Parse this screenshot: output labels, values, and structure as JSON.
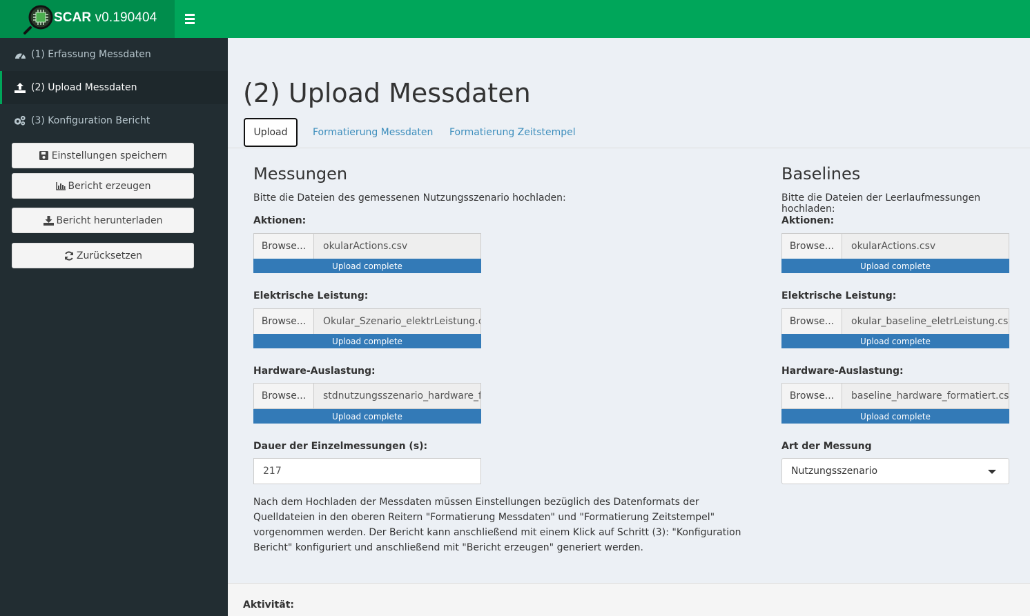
{
  "app": {
    "logo_mark": "O",
    "title": "SCAR",
    "version": "v0.190404",
    "logo_icon": "magnifier-chip-icon"
  },
  "sidebar": {
    "items": [
      {
        "label": "(1) Erfassung Messdaten",
        "icon": "dashboard-icon"
      },
      {
        "label": "(2) Upload Messdaten",
        "icon": "upload-icon"
      },
      {
        "label": "(3) Konfiguration Bericht",
        "icon": "gears-icon"
      }
    ],
    "buttons": [
      {
        "label": "Einstellungen speichern",
        "icon": "floppy-icon"
      },
      {
        "label": "Bericht erzeugen",
        "icon": "bar-chart-icon"
      },
      {
        "label": "Bericht herunterladen",
        "icon": "download-icon"
      },
      {
        "label": "Zurücksetzen",
        "icon": "refresh-icon"
      }
    ]
  },
  "page": {
    "title": "(2) Upload Messdaten",
    "tabs": [
      "Upload",
      "Formatierung Messdaten",
      "Formatierung Zeitstempel"
    ]
  },
  "messungen": {
    "title": "Messungen",
    "desc": "Bitte die Dateien des gemessenen Nutzungsszenario hochladen:",
    "files": [
      {
        "label": "Aktionen:",
        "browse": "Browse...",
        "file": "okularActions.csv",
        "status": "Upload complete"
      },
      {
        "label": "Elektrische Leistung:",
        "browse": "Browse...",
        "file": "Okular_Szenario_elektrLeistung.csv",
        "status": "Upload complete"
      },
      {
        "label": "Hardware-Auslastung:",
        "browse": "Browse...",
        "file": "stdnutzungsszenario_hardware_formatiert.csv",
        "status": "Upload complete"
      }
    ],
    "duration_label": "Dauer der Einzelmessungen (s):",
    "duration_value": "217"
  },
  "baselines": {
    "title": "Baselines",
    "desc": "Bitte die Dateien der Leerlaufmessungen hochladen:",
    "files": [
      {
        "label": "Aktionen:",
        "browse": "Browse...",
        "file": "okularActions.csv",
        "status": "Upload complete"
      },
      {
        "label": "Elektrische Leistung:",
        "browse": "Browse...",
        "file": "okular_baseline_eletrLeistung.csv",
        "status": "Upload complete"
      },
      {
        "label": "Hardware-Auslastung:",
        "browse": "Browse...",
        "file": "baseline_hardware_formatiert.csv",
        "status": "Upload complete"
      }
    ],
    "type_label": "Art der Messung",
    "type_value": "Nutzungsszenario"
  },
  "info": "Nach dem Hochladen der Messdaten müssen Einstellungen bezüglich des Datenformats der Quelldateien in den oberen Reitern \"Formatierung Messdaten\" und \"Formatierung Zeitstempel\" vorgenommen werden. Der Bericht kann anschließend mit einem Klick auf Schritt (3): \"Konfiguration Bericht\" konfiguriert und anschließend mit \"Bericht erzeugen\" generiert werden.",
  "activity_label": "Aktivität:",
  "colors": {
    "header": "#00a65a",
    "logo_bg": "#008d4c",
    "sidebar": "#222d32",
    "progress": "#337ab7",
    "link": "#3c8dbc"
  }
}
